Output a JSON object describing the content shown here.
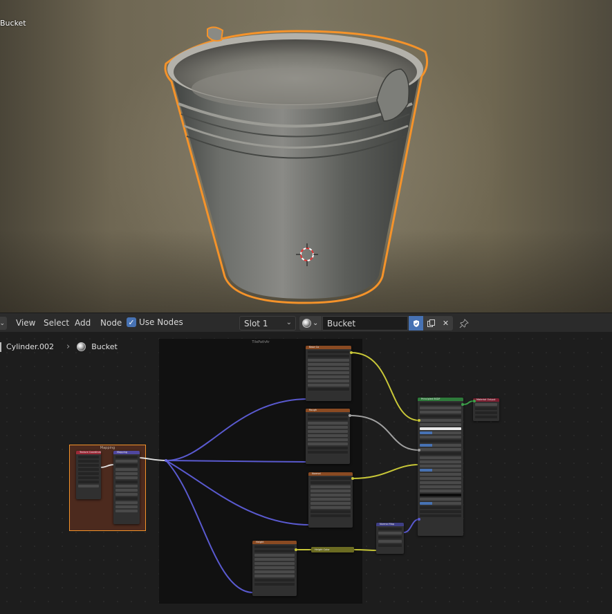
{
  "viewport": {
    "object_label": "Bucket",
    "colors": {
      "selection_outline": "#f5932a",
      "cursor_red": "#e23636"
    }
  },
  "header": {
    "menus": [
      "View",
      "Select",
      "Add",
      "Node"
    ],
    "use_nodes_label": "Use Nodes",
    "use_nodes_checked": true,
    "slot": "Slot 1",
    "material_name": "Bucket",
    "icons": {
      "browse": "material-sphere-icon",
      "fake_user": "shield-check-icon",
      "duplicate": "duplicate-icon",
      "unlink": "close-icon",
      "pin": "pin-icon"
    }
  },
  "breadcrumb": {
    "object": "Cylinder.002",
    "material": "Bucket"
  },
  "node_editor": {
    "frames": [
      {
        "id": "texture-frame",
        "label": "TilePathAr"
      },
      {
        "id": "mapping-frame",
        "label": "Mapping"
      }
    ],
    "nodes": [
      {
        "id": "texcoord",
        "title": "Texture Coordinate",
        "color": "#9b2a38"
      },
      {
        "id": "mapping",
        "title": "Mapping",
        "color": "#4f47a0"
      },
      {
        "id": "tex-basecolor",
        "title": "Base Co",
        "color": "#8a4a22"
      },
      {
        "id": "tex-rough",
        "title": "Rough",
        "color": "#8a4a22"
      },
      {
        "id": "tex-normal",
        "title": "Normal",
        "color": "#8a4a22"
      },
      {
        "id": "tex-height",
        "title": "Height",
        "color": "#8a4a22"
      },
      {
        "id": "normal-map",
        "title": "Normal Map",
        "color": "#3f3f86"
      },
      {
        "id": "bsdf",
        "title": "Principled BSDF",
        "color": "#2e7a3a"
      },
      {
        "id": "output",
        "title": "Material Output",
        "color": "#7a1e30"
      },
      {
        "id": "reroute-height",
        "title": "Height Color",
        "color": "#6b6b22"
      }
    ]
  }
}
